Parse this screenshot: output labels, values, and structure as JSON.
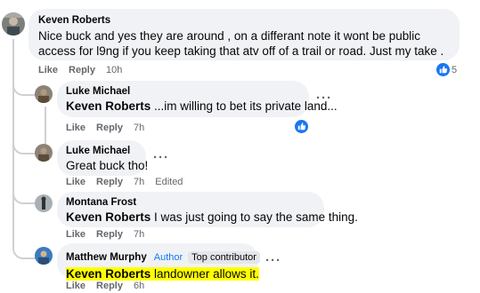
{
  "comments": [
    {
      "author": "Keven Roberts",
      "text": "Nice buck and yes they are around , on a differant note it wont be public access for l9ng if you keep taking that atv off of a trail or road. Just my take .",
      "time": "10h",
      "like_label": "Like",
      "reply_label": "Reply",
      "reaction_count": "5"
    },
    {
      "author": "Luke Michael",
      "mention": "Keven Roberts",
      "text": " ...im willing to bet its private land...",
      "like_label": "Like",
      "reply_label": "Reply",
      "time": "7h"
    },
    {
      "author": "Luke Michael",
      "text": "Great buck tho!",
      "like_label": "Like",
      "reply_label": "Reply",
      "time": "7h",
      "edited": "Edited"
    },
    {
      "author": "Montana Frost",
      "mention": "Keven Roberts",
      "text": " I was just going to say the same thing.",
      "like_label": "Like",
      "reply_label": "Reply",
      "time": "7h"
    },
    {
      "author": "Matthew Murphy",
      "author_badge": "Author",
      "contributor_badge": "Top contributor",
      "mention": "Keven Roberts",
      "text": " landowner allows it.",
      "like_label": "Like",
      "reply_label": "Reply",
      "time": "6h"
    }
  ],
  "colors": {
    "bubble": "#f0f2f5",
    "meta": "#65676b",
    "accent": "#1877f2",
    "highlight": "#ffff00"
  }
}
